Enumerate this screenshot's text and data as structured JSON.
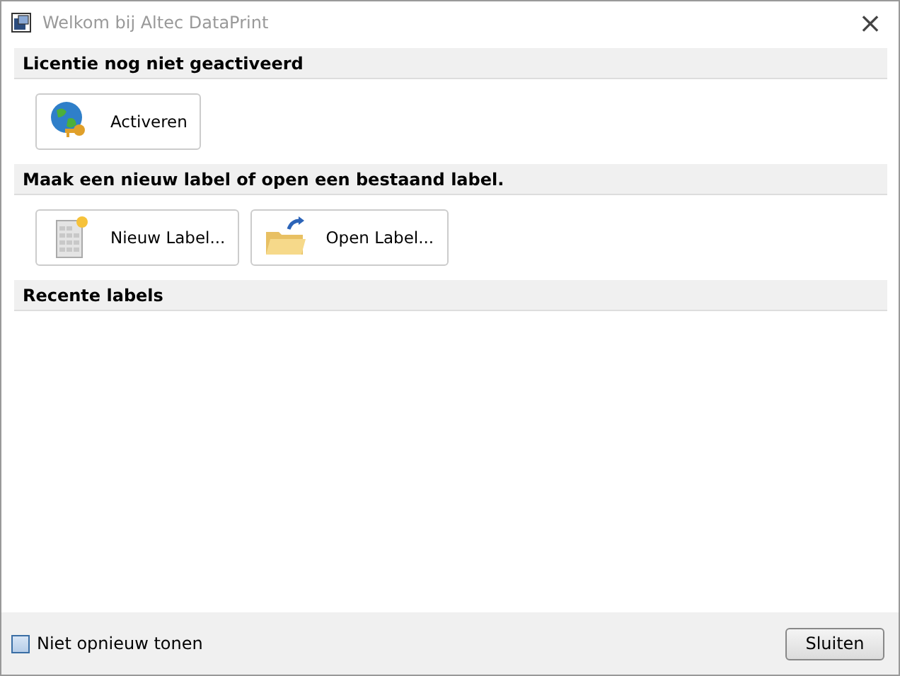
{
  "window": {
    "title": "Welkom bij Altec DataPrint",
    "close": "×"
  },
  "sections": [
    {
      "title": "Licentie nog niet geactiveerd",
      "buttons": [
        {
          "label": "Activeren",
          "kind": "activate"
        }
      ]
    },
    {
      "title": "Maak een nieuw label of open een bestaand label.",
      "buttons": [
        {
          "label": "Nieuw Label...",
          "kind": "new"
        },
        {
          "label": "Open Label...",
          "kind": "open"
        }
      ]
    },
    {
      "title": "Recente labels"
    }
  ],
  "footer": {
    "checkbox": {
      "label": "Niet opnieuw tonen",
      "checked": false
    },
    "button": "Sluiten"
  }
}
